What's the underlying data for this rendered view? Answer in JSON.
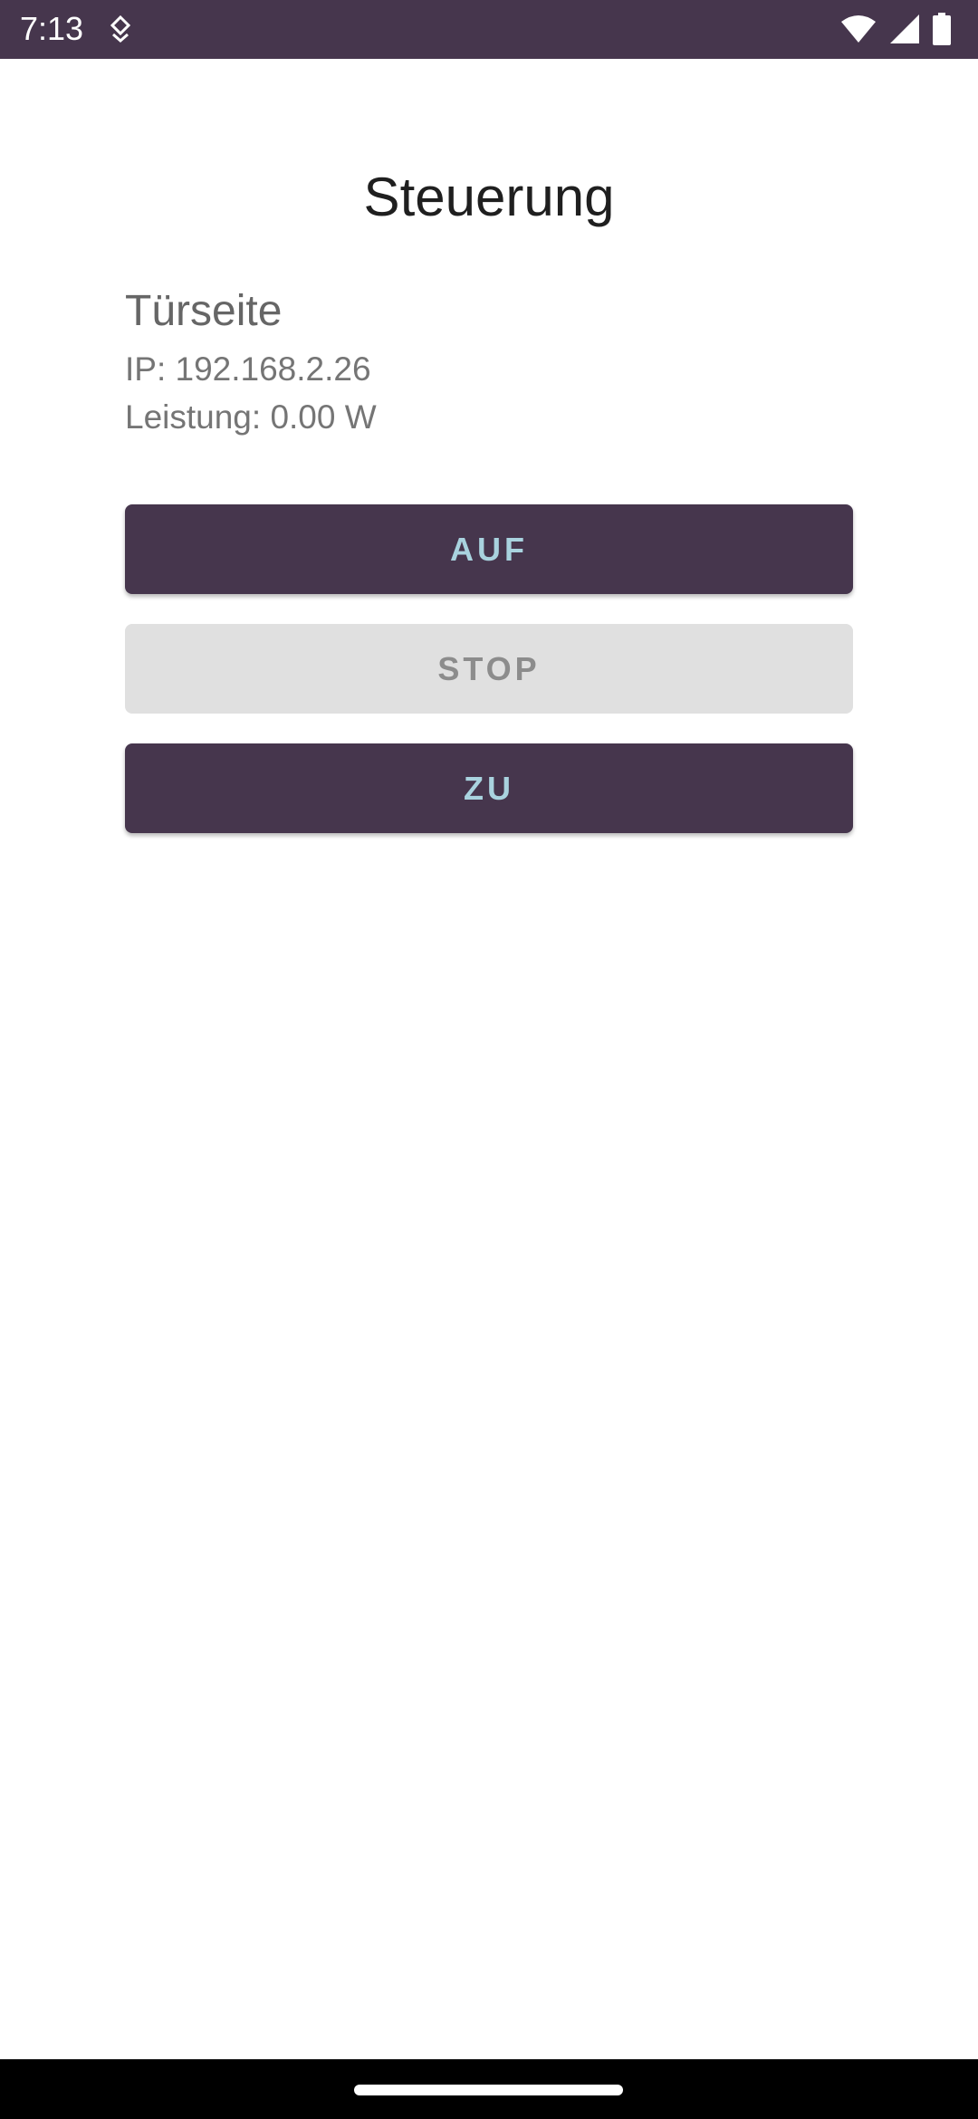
{
  "status_bar": {
    "time": "7:13",
    "background": "#46364d",
    "icons": [
      "notification-icon",
      "wifi-icon",
      "signal-icon",
      "battery-icon"
    ]
  },
  "main": {
    "title": "Steuerung",
    "device": {
      "name": "Türseite",
      "ip": "IP: 192.168.2.26",
      "power": "Leistung: 0.00 W"
    },
    "buttons": [
      {
        "label": "AUF",
        "enabled": true
      },
      {
        "label": "STOP",
        "enabled": false
      },
      {
        "label": "ZU",
        "enabled": true
      }
    ]
  },
  "colors": {
    "accent": "#46364d",
    "button_text": "#a9d3df",
    "disabled_bg": "#e0e0e0",
    "disabled_text": "#8c8c8c"
  }
}
